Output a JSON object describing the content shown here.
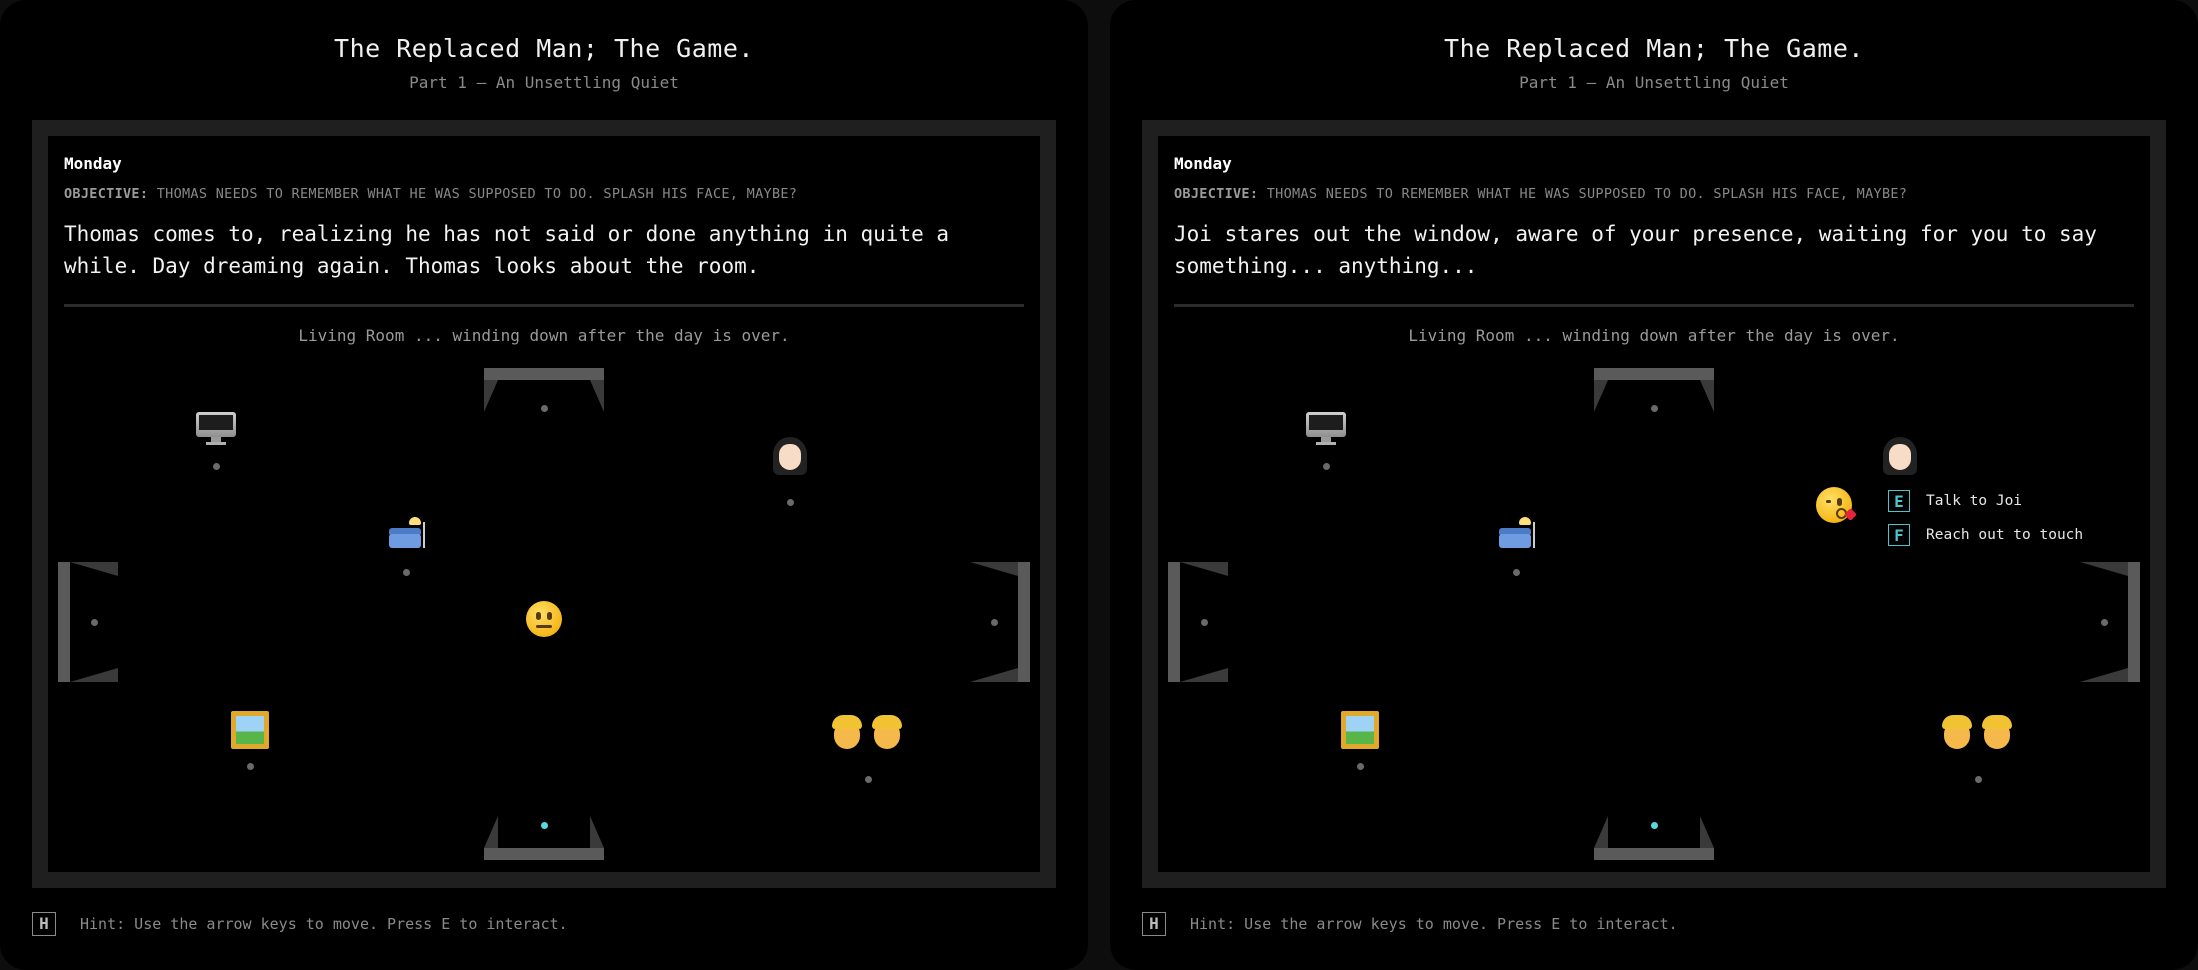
{
  "game": {
    "title": "The Replaced Man; The Game.",
    "subtitle": "Part 1 – An Unsettling Quiet",
    "day": "Monday",
    "objective_label": "OBJECTIVE:",
    "objective_text": "THOMAS NEEDS TO REMEMBER WHAT HE WAS SUPPOSED TO DO. SPLASH HIS FACE, MAYBE?",
    "room_description": "Living Room ... winding down after the day is over.",
    "hint_key": "H",
    "hint_text": "Hint: Use the arrow keys to move. Press E to interact."
  },
  "panels": [
    {
      "narration": "Thomas comes to, realizing he has not said or done anything in quite a while. Day dreaming again. Thomas looks about the room.",
      "player_icon": "neutral-face-icon"
    },
    {
      "narration": "Joi stares out the window, aware of your presence, waiting for you to say something... anything...",
      "player_icon": "kissing-face-icon",
      "interaction_menu": [
        {
          "key": "E",
          "label": "Talk to Joi"
        },
        {
          "key": "F",
          "label": "Reach out to touch"
        }
      ]
    }
  ],
  "room_objects": [
    {
      "name": "computer",
      "icon": "desktop-computer-icon"
    },
    {
      "name": "couch-and-lamp",
      "icon": "couch-lamp-icon"
    },
    {
      "name": "joi",
      "icon": "woman-icon"
    },
    {
      "name": "framed-picture",
      "icon": "framed-picture-icon"
    },
    {
      "name": "children",
      "icon": "children-icon"
    }
  ],
  "colors": {
    "background": "#000000",
    "frame": "#1f1f1f",
    "door": "#5a5a5a",
    "accent": "#4fc3cc",
    "player_dot": "#57d7e0"
  }
}
